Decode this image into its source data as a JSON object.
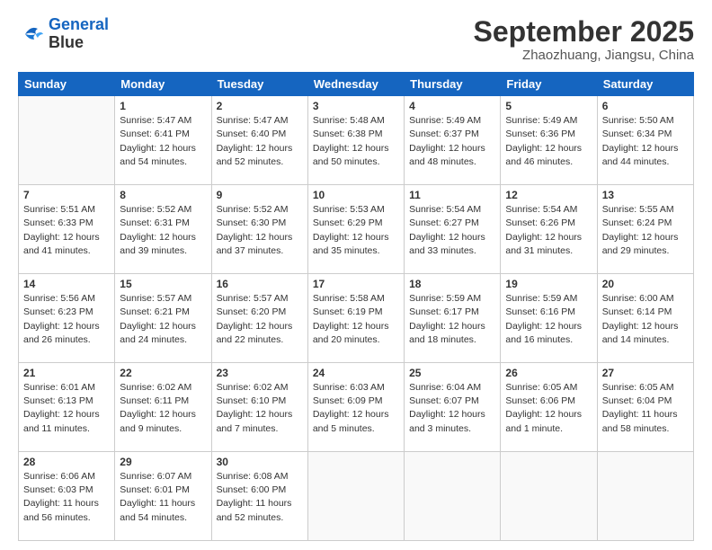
{
  "logo": {
    "line1": "General",
    "line2": "Blue"
  },
  "title": "September 2025",
  "location": "Zhaozhuang, Jiangsu, China",
  "weekdays": [
    "Sunday",
    "Monday",
    "Tuesday",
    "Wednesday",
    "Thursday",
    "Friday",
    "Saturday"
  ],
  "weeks": [
    [
      {
        "day": "",
        "content": ""
      },
      {
        "day": "1",
        "content": "Sunrise: 5:47 AM\nSunset: 6:41 PM\nDaylight: 12 hours\nand 54 minutes."
      },
      {
        "day": "2",
        "content": "Sunrise: 5:47 AM\nSunset: 6:40 PM\nDaylight: 12 hours\nand 52 minutes."
      },
      {
        "day": "3",
        "content": "Sunrise: 5:48 AM\nSunset: 6:38 PM\nDaylight: 12 hours\nand 50 minutes."
      },
      {
        "day": "4",
        "content": "Sunrise: 5:49 AM\nSunset: 6:37 PM\nDaylight: 12 hours\nand 48 minutes."
      },
      {
        "day": "5",
        "content": "Sunrise: 5:49 AM\nSunset: 6:36 PM\nDaylight: 12 hours\nand 46 minutes."
      },
      {
        "day": "6",
        "content": "Sunrise: 5:50 AM\nSunset: 6:34 PM\nDaylight: 12 hours\nand 44 minutes."
      }
    ],
    [
      {
        "day": "7",
        "content": "Sunrise: 5:51 AM\nSunset: 6:33 PM\nDaylight: 12 hours\nand 41 minutes."
      },
      {
        "day": "8",
        "content": "Sunrise: 5:52 AM\nSunset: 6:31 PM\nDaylight: 12 hours\nand 39 minutes."
      },
      {
        "day": "9",
        "content": "Sunrise: 5:52 AM\nSunset: 6:30 PM\nDaylight: 12 hours\nand 37 minutes."
      },
      {
        "day": "10",
        "content": "Sunrise: 5:53 AM\nSunset: 6:29 PM\nDaylight: 12 hours\nand 35 minutes."
      },
      {
        "day": "11",
        "content": "Sunrise: 5:54 AM\nSunset: 6:27 PM\nDaylight: 12 hours\nand 33 minutes."
      },
      {
        "day": "12",
        "content": "Sunrise: 5:54 AM\nSunset: 6:26 PM\nDaylight: 12 hours\nand 31 minutes."
      },
      {
        "day": "13",
        "content": "Sunrise: 5:55 AM\nSunset: 6:24 PM\nDaylight: 12 hours\nand 29 minutes."
      }
    ],
    [
      {
        "day": "14",
        "content": "Sunrise: 5:56 AM\nSunset: 6:23 PM\nDaylight: 12 hours\nand 26 minutes."
      },
      {
        "day": "15",
        "content": "Sunrise: 5:57 AM\nSunset: 6:21 PM\nDaylight: 12 hours\nand 24 minutes."
      },
      {
        "day": "16",
        "content": "Sunrise: 5:57 AM\nSunset: 6:20 PM\nDaylight: 12 hours\nand 22 minutes."
      },
      {
        "day": "17",
        "content": "Sunrise: 5:58 AM\nSunset: 6:19 PM\nDaylight: 12 hours\nand 20 minutes."
      },
      {
        "day": "18",
        "content": "Sunrise: 5:59 AM\nSunset: 6:17 PM\nDaylight: 12 hours\nand 18 minutes."
      },
      {
        "day": "19",
        "content": "Sunrise: 5:59 AM\nSunset: 6:16 PM\nDaylight: 12 hours\nand 16 minutes."
      },
      {
        "day": "20",
        "content": "Sunrise: 6:00 AM\nSunset: 6:14 PM\nDaylight: 12 hours\nand 14 minutes."
      }
    ],
    [
      {
        "day": "21",
        "content": "Sunrise: 6:01 AM\nSunset: 6:13 PM\nDaylight: 12 hours\nand 11 minutes."
      },
      {
        "day": "22",
        "content": "Sunrise: 6:02 AM\nSunset: 6:11 PM\nDaylight: 12 hours\nand 9 minutes."
      },
      {
        "day": "23",
        "content": "Sunrise: 6:02 AM\nSunset: 6:10 PM\nDaylight: 12 hours\nand 7 minutes."
      },
      {
        "day": "24",
        "content": "Sunrise: 6:03 AM\nSunset: 6:09 PM\nDaylight: 12 hours\nand 5 minutes."
      },
      {
        "day": "25",
        "content": "Sunrise: 6:04 AM\nSunset: 6:07 PM\nDaylight: 12 hours\nand 3 minutes."
      },
      {
        "day": "26",
        "content": "Sunrise: 6:05 AM\nSunset: 6:06 PM\nDaylight: 12 hours\nand 1 minute."
      },
      {
        "day": "27",
        "content": "Sunrise: 6:05 AM\nSunset: 6:04 PM\nDaylight: 11 hours\nand 58 minutes."
      }
    ],
    [
      {
        "day": "28",
        "content": "Sunrise: 6:06 AM\nSunset: 6:03 PM\nDaylight: 11 hours\nand 56 minutes."
      },
      {
        "day": "29",
        "content": "Sunrise: 6:07 AM\nSunset: 6:01 PM\nDaylight: 11 hours\nand 54 minutes."
      },
      {
        "day": "30",
        "content": "Sunrise: 6:08 AM\nSunset: 6:00 PM\nDaylight: 11 hours\nand 52 minutes."
      },
      {
        "day": "",
        "content": ""
      },
      {
        "day": "",
        "content": ""
      },
      {
        "day": "",
        "content": ""
      },
      {
        "day": "",
        "content": ""
      }
    ]
  ]
}
